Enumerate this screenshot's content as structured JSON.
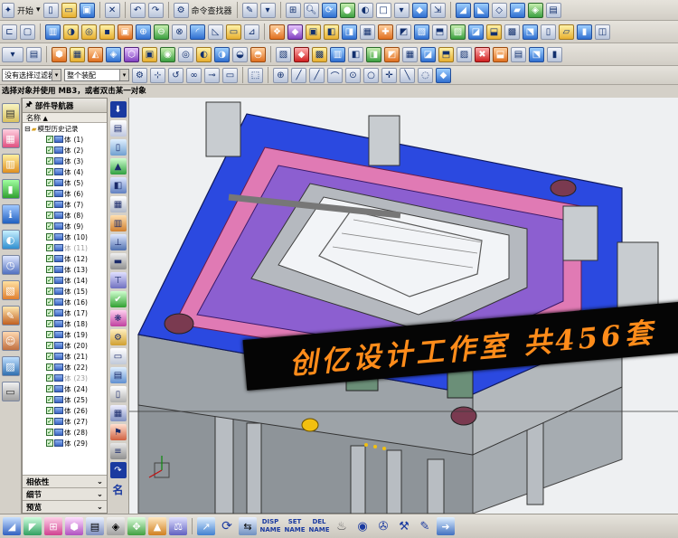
{
  "toolbar": {
    "start_label": "开始",
    "command_finder_label": "命令查找器"
  },
  "selection": {
    "filter_value": "没有选择过滤器",
    "scope_value": "整个装配"
  },
  "status": {
    "prompt": "选择对象并使用 MB3，或者双击某一对象"
  },
  "navigator": {
    "title": "部件导航器",
    "column_name": "名称",
    "root": "模型历史记录",
    "item_prefix": "体",
    "items": [
      "(1)",
      "(2)",
      "(3)",
      "(4)",
      "(5)",
      "(6)",
      "(7)",
      "(8)",
      "(9)",
      "(10)",
      "(11)",
      "(12)",
      "(13)",
      "(14)",
      "(15)",
      "(16)",
      "(17)",
      "(18)",
      "(19)",
      "(20)",
      "(21)",
      "(22)",
      "(23)",
      "(24)",
      "(25)",
      "(26)",
      "(27)",
      "(28)",
      "(29)"
    ],
    "ghost_items": [
      10,
      22
    ],
    "sections": [
      "相依性",
      "细节",
      "预览"
    ]
  },
  "bottom": {
    "disp_name": [
      "DISP",
      "NAME"
    ],
    "set_name": [
      "SET",
      "NAME"
    ],
    "del_name": [
      "DEL",
      "NAME"
    ]
  },
  "watermark": "创亿设计工作室 共456套",
  "colors": {
    "mold_blue": "#2b49e0",
    "mold_pink": "#e07ab4",
    "mold_gray": "#9aa0a6",
    "banner_text": "#ff8c1a",
    "banner_bg": "#050505"
  }
}
